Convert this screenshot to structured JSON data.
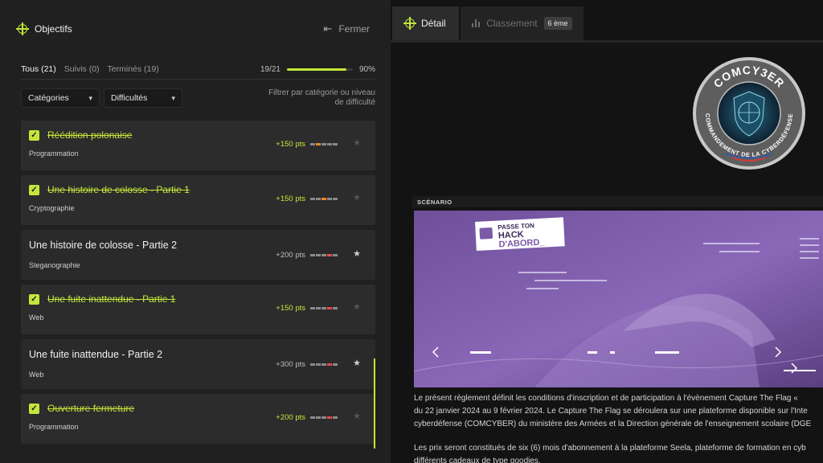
{
  "left": {
    "title": "Objectifs",
    "close_label": "Fermer",
    "tabs": [
      {
        "label": "Tous (21)",
        "active": true
      },
      {
        "label": "Suivis (0)",
        "active": false
      },
      {
        "label": "Terminés (19)",
        "active": false
      }
    ],
    "progress": {
      "count": "19/21",
      "percent": "90%",
      "fraction": 0.9
    },
    "dropdowns": {
      "categories": "Catégories",
      "difficulties": "Difficultés"
    },
    "filter_hint": "Filtrer par catégorie ou niveau de difficulté",
    "challenges": [
      {
        "title": "Réédition polonaise",
        "category": "Programmation",
        "points": "+150 pts",
        "done": true,
        "difficulty": [
          "#8a8a8a",
          "#f08a24",
          "#8a8a8a",
          "#8a8a8a",
          "#8a8a8a"
        ]
      },
      {
        "title": "Une histoire de colosse - Partie 1",
        "category": "Cryptographie",
        "points": "+150 pts",
        "done": true,
        "difficulty": [
          "#8a8a8a",
          "#8a8a8a",
          "#f08a24",
          "#8a8a8a",
          "#8a8a8a"
        ]
      },
      {
        "title": "Une histoire de colosse - Partie 2",
        "category": "Steganographie",
        "points": "+200 pts",
        "done": false,
        "difficulty": [
          "#8a8a8a",
          "#8a8a8a",
          "#8a8a8a",
          "#e84a4a",
          "#8a8a8a"
        ]
      },
      {
        "title": "Une fuite inattendue - Partie 1",
        "category": "Web",
        "points": "+150 pts",
        "done": true,
        "difficulty": [
          "#8a8a8a",
          "#8a8a8a",
          "#8a8a8a",
          "#e84a4a",
          "#8a8a8a"
        ]
      },
      {
        "title": "Une fuite inattendue - Partie 2",
        "category": "Web",
        "points": "+300 pts",
        "done": false,
        "difficulty": [
          "#8a8a8a",
          "#8a8a8a",
          "#8a8a8a",
          "#e84a4a",
          "#8a8a8a"
        ]
      },
      {
        "title": "Ouverture fermeture",
        "category": "Programmation",
        "points": "+200 pts",
        "done": true,
        "difficulty": [
          "#8a8a8a",
          "#8a8a8a",
          "#8a8a8a",
          "#e84a4a",
          "#8a8a8a"
        ]
      }
    ]
  },
  "right": {
    "tabs": {
      "detail": "Détail",
      "ranking": "Classement",
      "rank_badge": "6 ème"
    },
    "badge_text": {
      "top": "COMCY3ER",
      "bottom": "COMMANDEMENT DE LA CYBERDÉFENSE"
    },
    "scenario_label": "SCÉNARIO",
    "image_logo": {
      "line1": "PASSE TON",
      "line2": "HACK",
      "line3": "D'ABORD_"
    },
    "paragraphs": [
      [
        "Le présent règlement définit les conditions d'inscription et de participation à l'évènement Capture The Flag «",
        "du 22 janvier 2024 au 9 février 2024. Le Capture The Flag se déroulera sur une plateforme disponible sur l'Inte",
        "cyberdéfense (COMCYBER) du ministère des Armées et la Direction générale de l'enseignement scolaire (DGE"
      ],
      [
        "Les prix seront constitués de six (6) mois d'abonnement à la plateforme Seela, plateforme de formation en cyb",
        "différents cadeaux de type goodies."
      ]
    ]
  },
  "colors": {
    "accent": "#c4e63c",
    "panel": "#202020",
    "card": "#2a2a2a",
    "background": "#131313",
    "purple": "#7b5aa6"
  }
}
